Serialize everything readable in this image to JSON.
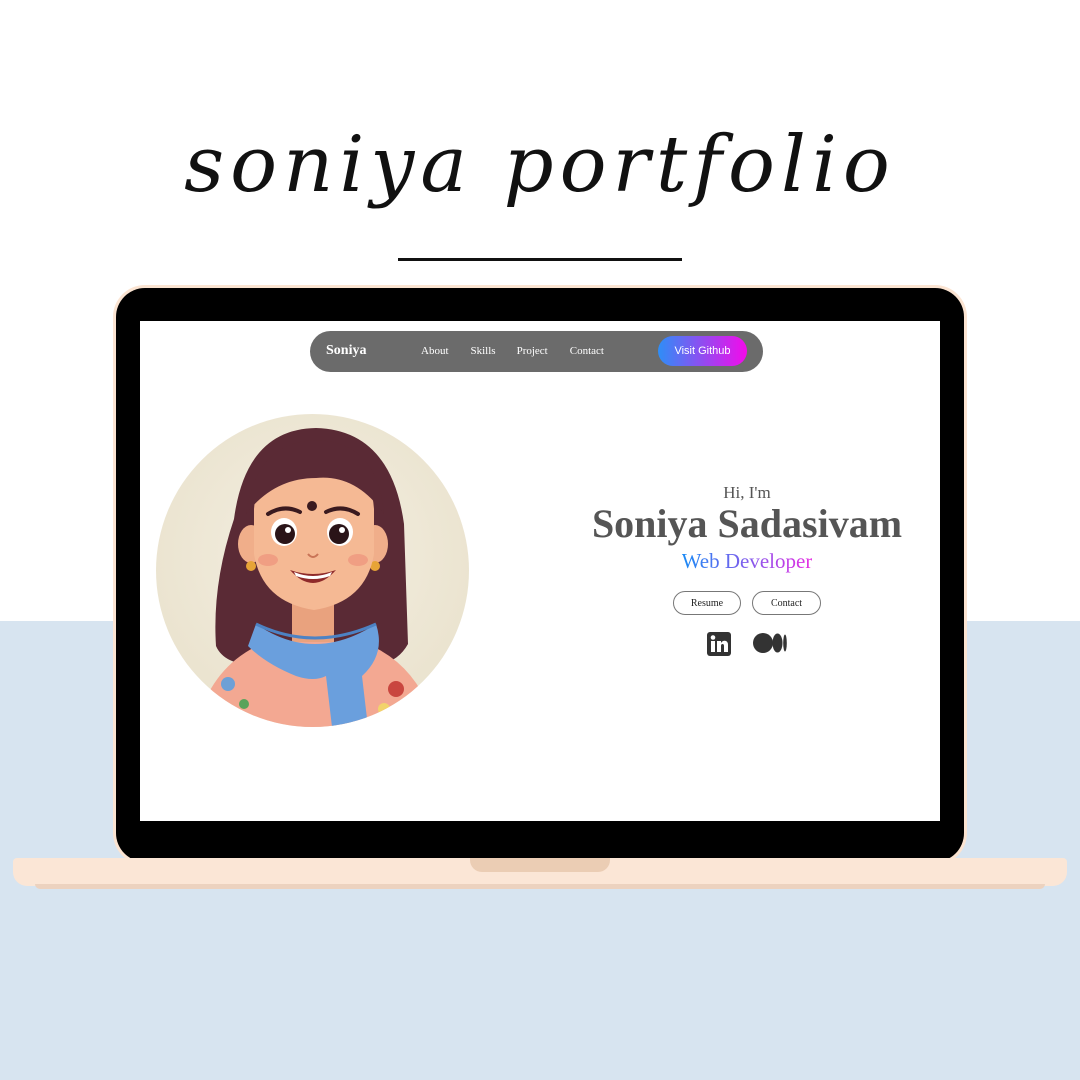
{
  "hero": {
    "title": "soniya portfolio"
  },
  "navbar": {
    "logo": "Soniya",
    "links": [
      "About",
      "Skills",
      "Project",
      "Contact"
    ],
    "github_button": "Visit Github"
  },
  "intro": {
    "greeting": "Hi, I'm",
    "name": "Soniya Sadasivam",
    "role": "Web Developer",
    "buttons": {
      "resume": "Resume",
      "contact": "Contact"
    }
  },
  "socials": [
    "linkedin-icon",
    "medium-icon"
  ],
  "colors": {
    "page_bottom": "#d7e4f0",
    "laptop_shell": "#fbe4d2",
    "navbar": "#6b6b6b",
    "gradient_start": "#2e8ef7",
    "gradient_end": "#f40aea",
    "text_gray": "#555555"
  }
}
